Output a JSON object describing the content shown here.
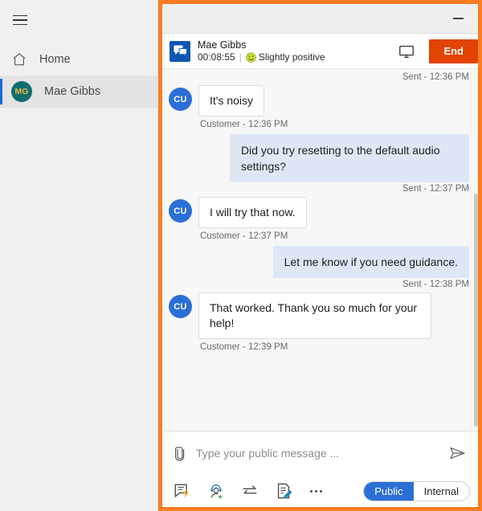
{
  "sidebar": {
    "menu_icon": "hamburger-icon",
    "items": [
      {
        "label": "Home",
        "icon": "home-icon",
        "active": false
      },
      {
        "label": "Mae Gibbs",
        "icon": "avatar",
        "initials": "MG",
        "active": true
      }
    ]
  },
  "chat_panel": {
    "titlebar": {
      "minimize_icon": "minimize-icon"
    },
    "header": {
      "conversation_icon": "chat-bubble-icon",
      "name": "Mae Gibbs",
      "duration": "00:08:55",
      "divider": "|",
      "sentiment_icon": "slightly-positive-face-icon",
      "sentiment": "Slightly positive",
      "monitor_icon": "monitor-icon",
      "end_label": "End"
    },
    "messages": [
      {
        "kind": "status",
        "direction": "out",
        "text": "Sent - 12:36 PM"
      },
      {
        "kind": "bubble",
        "direction": "in",
        "avatar": "CU",
        "text": "It's noisy",
        "meta": "Customer - 12:36 PM"
      },
      {
        "kind": "bubble",
        "direction": "out",
        "text": "Did you try resetting to the default audio settings?"
      },
      {
        "kind": "status",
        "direction": "out",
        "text": "Sent - 12:37 PM"
      },
      {
        "kind": "bubble",
        "direction": "in",
        "avatar": "CU",
        "text": "I will try that now.",
        "meta": "Customer - 12:37 PM"
      },
      {
        "kind": "bubble",
        "direction": "out",
        "text": "Let me know if you need guidance."
      },
      {
        "kind": "status",
        "direction": "out",
        "text": "Sent - 12:38 PM"
      },
      {
        "kind": "bubble",
        "direction": "in",
        "avatar": "CU",
        "text": "That worked. Thank you so much for your help!",
        "meta": "Customer - 12:39 PM"
      }
    ],
    "composer": {
      "attach_icon": "paperclip-icon",
      "placeholder": "Type your public message ...",
      "input_value": "",
      "send_icon": "send-icon",
      "tools": [
        {
          "icon": "quick-reply-icon",
          "name": "quick-reply"
        },
        {
          "icon": "add-agent-icon",
          "name": "add-agent"
        },
        {
          "icon": "transfer-icon",
          "name": "transfer"
        },
        {
          "icon": "note-icon",
          "name": "note"
        },
        {
          "icon": "more-icon",
          "name": "more"
        }
      ],
      "visibility": {
        "options": [
          "Public",
          "Internal"
        ],
        "selected": "Public"
      }
    }
  },
  "colors": {
    "panel_border": "#fb7c21",
    "end_button": "#e24301",
    "avatar_customer": "#2b6fd6",
    "bubble_out": "#dfe7f7",
    "accent_blue": "#2b6fd6",
    "sidebar_avatar": "#106e6e",
    "sidebar_avatar_text": "#f2b640"
  }
}
